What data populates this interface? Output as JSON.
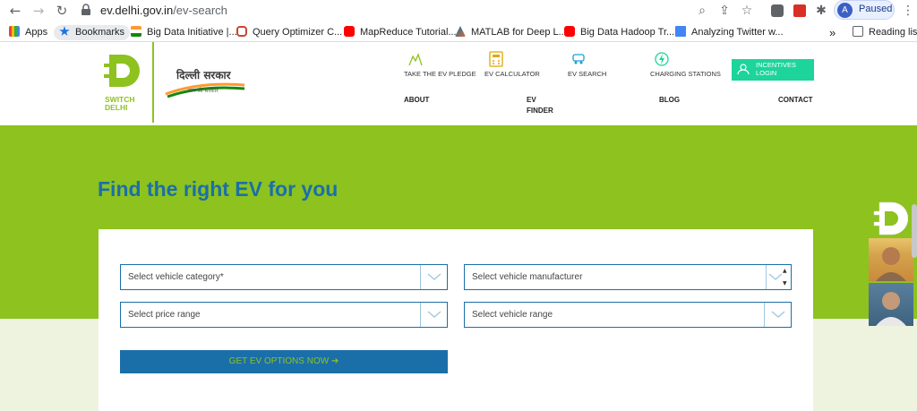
{
  "browser": {
    "url_host": "ev.delhi.gov.in",
    "url_path": "/ev-search",
    "profile_initial": "A",
    "profile_status": "Paused",
    "bookmarks": [
      {
        "label": "Apps"
      },
      {
        "label": "Bookmarks"
      },
      {
        "label": "Big Data Initiative |..."
      },
      {
        "label": "Query Optimizer C..."
      },
      {
        "label": "MapReduce Tutorial..."
      },
      {
        "label": "MATLAB for Deep L..."
      },
      {
        "label": "Big Data Hadoop Tr..."
      },
      {
        "label": "Analyzing Twitter w..."
      },
      {
        "label": "Reading list"
      }
    ],
    "overflow": "»"
  },
  "header": {
    "logo_text_1": "SWITCH",
    "logo_text_2": "DELHI",
    "gov_title": "दिल्ली सरकार",
    "gov_tagline": "आप की सरकार",
    "top_links": [
      {
        "label": "TAKE THE EV PLEDGE"
      },
      {
        "label": "EV CALCULATOR"
      },
      {
        "label": "EV SEARCH"
      },
      {
        "label": "CHARGING STATIONS"
      }
    ],
    "incentives_1": "INCENTIVES",
    "incentives_2": "LOGIN",
    "main_nav": {
      "about": "ABOUT",
      "ev_finder_1": "EV",
      "ev_finder_2": "FINDER",
      "blog": "BLOG",
      "contact": "CONTACT"
    }
  },
  "hero": {
    "title": "Find the right EV for you"
  },
  "form": {
    "vehicle_category": "Select vehicle category*",
    "vehicle_manufacturer": "Select vehicle manufacturer",
    "price_range": "Select price range",
    "vehicle_range": "Select vehicle range",
    "submit": "GET EV OPTIONS NOW ➔"
  },
  "colors": {
    "brand_green": "#8dc21f",
    "brand_blue": "#1a6fa8",
    "accent_teal": "#1dd49a"
  }
}
